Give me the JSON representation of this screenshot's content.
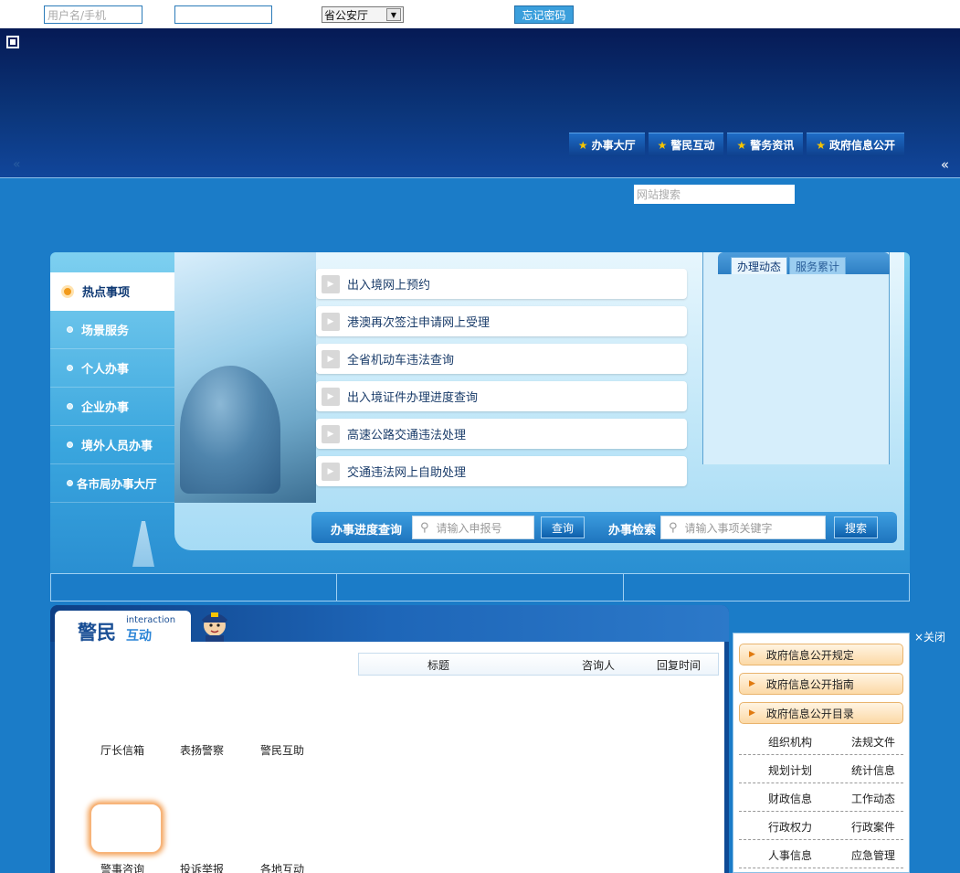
{
  "login": {
    "username_placeholder": "用户名/手机",
    "dept_selected": "省公安厅",
    "forgot_password": "忘记密码"
  },
  "nav": {
    "items": [
      "办事大厅",
      "警民互动",
      "警务资讯",
      "政府信息公开"
    ],
    "arrow_left": "«",
    "arrow_right": "«"
  },
  "search": {
    "placeholder": "网站搜索"
  },
  "service": {
    "side_menu": [
      "热点事项",
      "场景服务",
      "个人办事",
      "企业办事",
      "境外人员办事",
      "各市局办事大厅"
    ],
    "hot_items": [
      "出入境网上预约",
      "港澳再次签注申请网上受理",
      "全省机动车违法查询",
      "出入境证件办理进度查询",
      "高速公路交通违法处理",
      "交通违法网上自助处理"
    ],
    "tabs": [
      "办理动态",
      "服务累计"
    ],
    "query": {
      "progress_label": "办事进度查询",
      "progress_placeholder": "请输入申报号",
      "query_btn": "查询",
      "search_label": "办事检索",
      "search_placeholder": "请输入事项关键字",
      "search_btn": "搜索"
    }
  },
  "interaction": {
    "title": "警民",
    "title_en": "interaction",
    "title_cn": "互动",
    "icons": [
      "厅长信箱",
      "表扬警察",
      "警民互助",
      "警事咨询",
      "投诉举报",
      "各地互动"
    ],
    "table_headers": [
      "标题",
      "咨询人",
      "回复时间"
    ]
  },
  "info": {
    "close": "×关闭",
    "buttons": [
      "政府信息公开规定",
      "政府信息公开指南",
      "政府信息公开目录"
    ],
    "links": [
      [
        "组织机构",
        "法规文件"
      ],
      [
        "规划计划",
        "统计信息"
      ],
      [
        "财政信息",
        "工作动态"
      ],
      [
        "行政权力",
        "行政案件"
      ],
      [
        "人事信息",
        "应急管理"
      ]
    ]
  }
}
